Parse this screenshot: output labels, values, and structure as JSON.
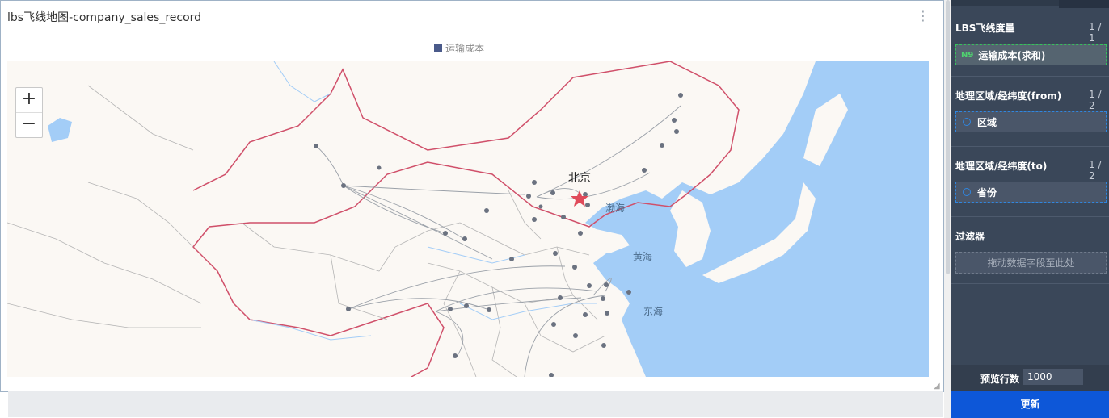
{
  "chart": {
    "title": "lbs飞线地图-company_sales_record",
    "legend_label": "运输成本",
    "legend_color": "#4a5a8a",
    "more_icon": "vertical-ellipsis-icon"
  },
  "map": {
    "zoom_in": "+",
    "zoom_out": "−",
    "labels": {
      "beijing": "北京",
      "bohai": "渤海",
      "yellow_sea": "黄海",
      "east_sea": "东海"
    },
    "colors": {
      "land": "#fbf8f4",
      "sea": "#a3cdf7",
      "border": "#d0506a",
      "province": "#b5b5b5",
      "point": "#6b7280",
      "star": "#e04a5a"
    }
  },
  "sidebar": {
    "sections": [
      {
        "title": "LBS飞线度量",
        "count": "1 / 1",
        "field_tag": "N9",
        "field": "运输成本(求和)"
      },
      {
        "title": "地理区域/经纬度(from)",
        "count": "1 / 2",
        "field": "区域"
      },
      {
        "title": "地理区域/经纬度(to)",
        "count": "1 / 2",
        "field": "省份"
      }
    ],
    "filter": {
      "title": "过滤器",
      "placeholder": "拖动数据字段至此处"
    },
    "preview": {
      "label": "预览行数",
      "value": "1000"
    },
    "update_button": "更新"
  }
}
